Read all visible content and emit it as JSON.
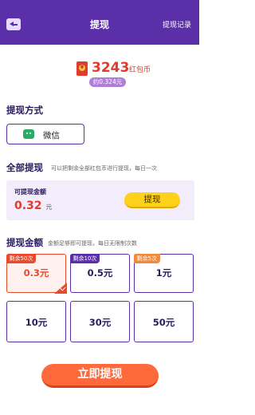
{
  "header": {
    "title": "提现",
    "right_link": "提现记录"
  },
  "coins": {
    "value": "3243",
    "unit": "红包币",
    "approx": "约0.324元"
  },
  "method": {
    "title": "提现方式",
    "option_label": "微信",
    "icon": "wechat-icon"
  },
  "full_withdraw": {
    "title": "全部提现",
    "note": "可以把剩余全部红包币进行提现，每日一次",
    "balance_label": "可提现金额",
    "balance_value": "0.32",
    "balance_unit": "元",
    "button_label": "提现"
  },
  "amount": {
    "title": "提现金额",
    "note": "金额足够即可提现，每日无限制次数",
    "options": [
      {
        "tag": "剩余50次",
        "label": "0.3元",
        "selected": true
      },
      {
        "tag": "剩余10次",
        "label": "0.5元",
        "selected": false
      },
      {
        "tag": "剩余5次",
        "label": "1元",
        "selected": false
      },
      {
        "tag": "",
        "label": "10元",
        "selected": false
      },
      {
        "tag": "",
        "label": "30元",
        "selected": false
      },
      {
        "tag": "",
        "label": "50元",
        "selected": false
      }
    ]
  },
  "submit": {
    "label": "立即提现"
  },
  "colors": {
    "accent": "#5b2fa8",
    "coin_red": "#e23a2c",
    "button_yellow": "#ffd11a",
    "button_orange": "#ff6a3d"
  }
}
